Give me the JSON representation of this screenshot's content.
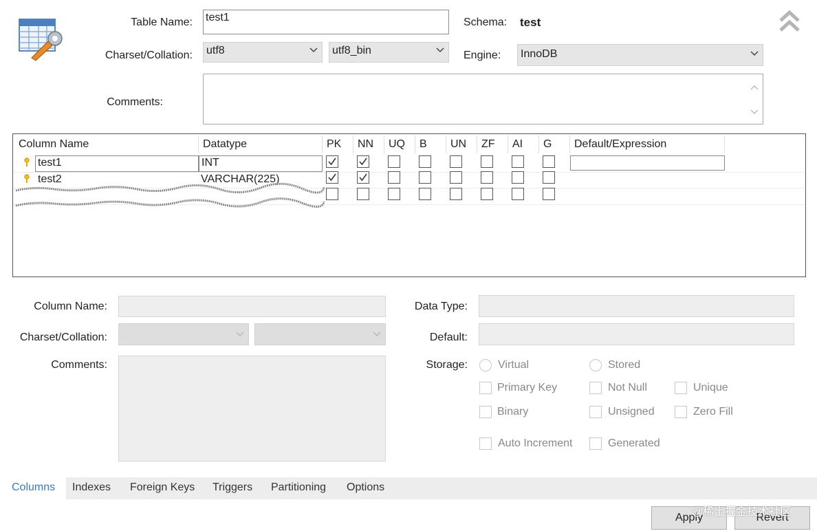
{
  "form": {
    "table_name_label": "Table Name:",
    "table_name_value": "test1",
    "schema_label": "Schema:",
    "schema_value": "test",
    "charset_label": "Charset/Collation:",
    "charset_value": "utf8",
    "collation_value": "utf8_bin",
    "engine_label": "Engine:",
    "engine_value": "InnoDB",
    "comments_label": "Comments:"
  },
  "grid": {
    "headers": [
      "Column Name",
      "Datatype",
      "PK",
      "NN",
      "UQ",
      "B",
      "UN",
      "ZF",
      "AI",
      "G",
      "Default/Expression"
    ],
    "rows": [
      {
        "name": "test1",
        "datatype": "INT",
        "pk": true,
        "nn": true,
        "uq": false,
        "b": false,
        "un": false,
        "zf": false,
        "ai": false,
        "g": false,
        "default": ""
      },
      {
        "name": "test2",
        "datatype": "VARCHAR(225)",
        "pk": true,
        "nn": true,
        "uq": false,
        "b": false,
        "un": false,
        "zf": false,
        "ai": false,
        "g": false,
        "default": ""
      }
    ]
  },
  "details": {
    "column_name_label": "Column Name:",
    "charset_label": "Charset/Collation:",
    "comments_label": "Comments:",
    "data_type_label": "Data Type:",
    "default_label": "Default:",
    "storage_label": "Storage:",
    "virtual_label": "Virtual",
    "stored_label": "Stored",
    "primary_key_label": "Primary Key",
    "not_null_label": "Not Null",
    "unique_label": "Unique",
    "binary_label": "Binary",
    "unsigned_label": "Unsigned",
    "zero_fill_label": "Zero Fill",
    "auto_increment_label": "Auto Increment",
    "generated_label": "Generated"
  },
  "tabs": [
    "Columns",
    "Indexes",
    "Foreign Keys",
    "Triggers",
    "Partitioning",
    "Options"
  ],
  "buttons": {
    "apply": "Apply",
    "revert": "Revert"
  },
  "watermark": "@稀土掘金技术社区",
  "colors": {
    "active_tab": "#3a7bbf",
    "tab_bar": "#ededed"
  },
  "icons": [
    "table-edit-icon",
    "collapse-chevrons-icon",
    "key-icon",
    "check-icon",
    "chevron-down-icon",
    "scroll-up-icon",
    "scroll-down-icon"
  ]
}
